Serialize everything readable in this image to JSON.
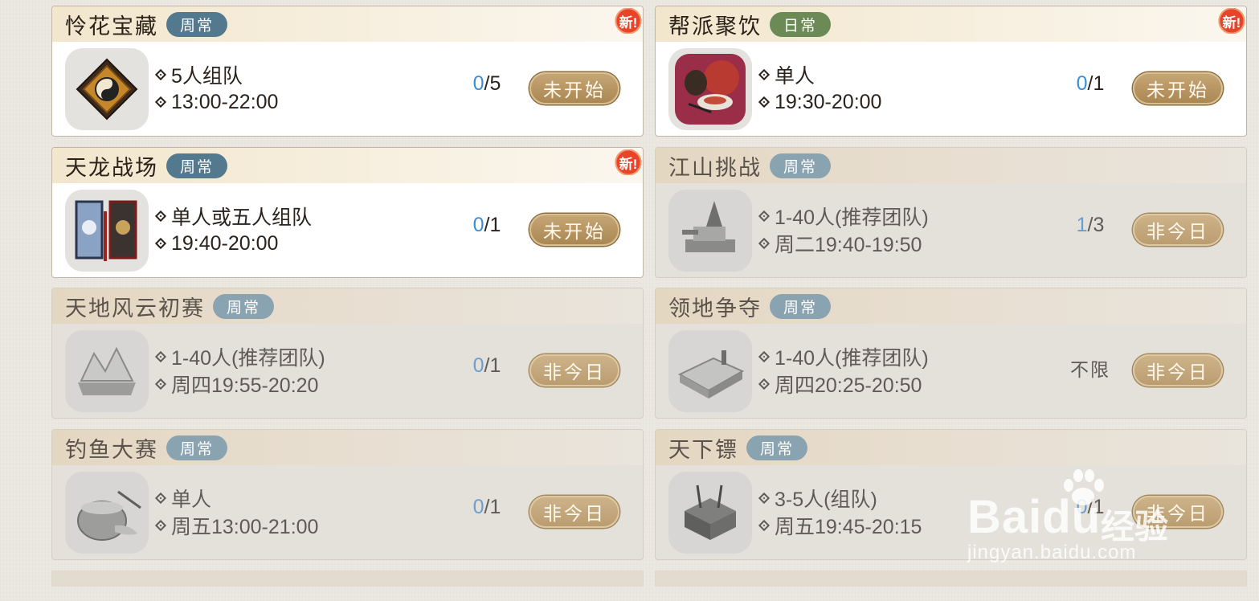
{
  "activities": [
    {
      "title": "怜花宝藏",
      "tag": "周常",
      "tag_type": "weekly",
      "is_new": true,
      "new_label": "新!",
      "icon": "bagua-mirror-icon",
      "line1": "5人组队",
      "line2": "13:00-22:00",
      "count_current": "0",
      "count_total": "/5",
      "status": "未开始",
      "state": "active"
    },
    {
      "title": "帮派聚饮",
      "tag": "日常",
      "tag_type": "daily",
      "is_new": true,
      "new_label": "新!",
      "icon": "feast-icon",
      "line1": "单人",
      "line2": "19:30-20:00",
      "count_current": "0",
      "count_total": "/1",
      "status": "未开始",
      "state": "active"
    },
    {
      "title": "天龙战场",
      "tag": "周常",
      "tag_type": "weekly",
      "is_new": true,
      "new_label": "新!",
      "icon": "battle-banners-icon",
      "line1": "单人或五人组队",
      "line2": "19:40-20:00",
      "count_current": "0",
      "count_total": "/1",
      "status": "未开始",
      "state": "active"
    },
    {
      "title": "江山挑战",
      "tag": "周常",
      "tag_type": "weekly",
      "is_new": false,
      "icon": "war-machine-icon",
      "line1": "1-40人(推荐团队)",
      "line2": "周二19:40-19:50",
      "count_current": "1",
      "count_total": "/3",
      "status": "非今日",
      "state": "inactive"
    },
    {
      "title": "天地风云初赛",
      "tag": "周常",
      "tag_type": "weekly",
      "is_new": false,
      "icon": "mountain-terrain-icon",
      "line1": "1-40人(推荐团队)",
      "line2": "周四19:55-20:20",
      "count_current": "0",
      "count_total": "/1",
      "status": "非今日",
      "state": "inactive"
    },
    {
      "title": "领地争夺",
      "tag": "周常",
      "tag_type": "weekly",
      "is_new": false,
      "icon": "territory-map-icon",
      "line1": "1-40人(推荐团队)",
      "line2": "周四20:25-20:50",
      "count_text": "不限",
      "status": "非今日",
      "state": "inactive"
    },
    {
      "title": "钓鱼大赛",
      "tag": "周常",
      "tag_type": "weekly",
      "is_new": false,
      "icon": "fishing-basket-icon",
      "line1": "单人",
      "line2": "周五13:00-21:00",
      "count_current": "0",
      "count_total": "/1",
      "status": "非今日",
      "state": "inactive"
    },
    {
      "title": "天下镖",
      "tag": "周常",
      "tag_type": "weekly",
      "is_new": false,
      "icon": "escort-chest-icon",
      "line1": "3-5人(组队)",
      "line2": "周五19:45-20:15",
      "count_current": "0",
      "count_total": "/1",
      "status": "非今日",
      "state": "inactive"
    }
  ],
  "watermark": {
    "brand": "Bai",
    "brand2": "du",
    "sub": "经验",
    "url": "jingyan.baidu.com"
  }
}
